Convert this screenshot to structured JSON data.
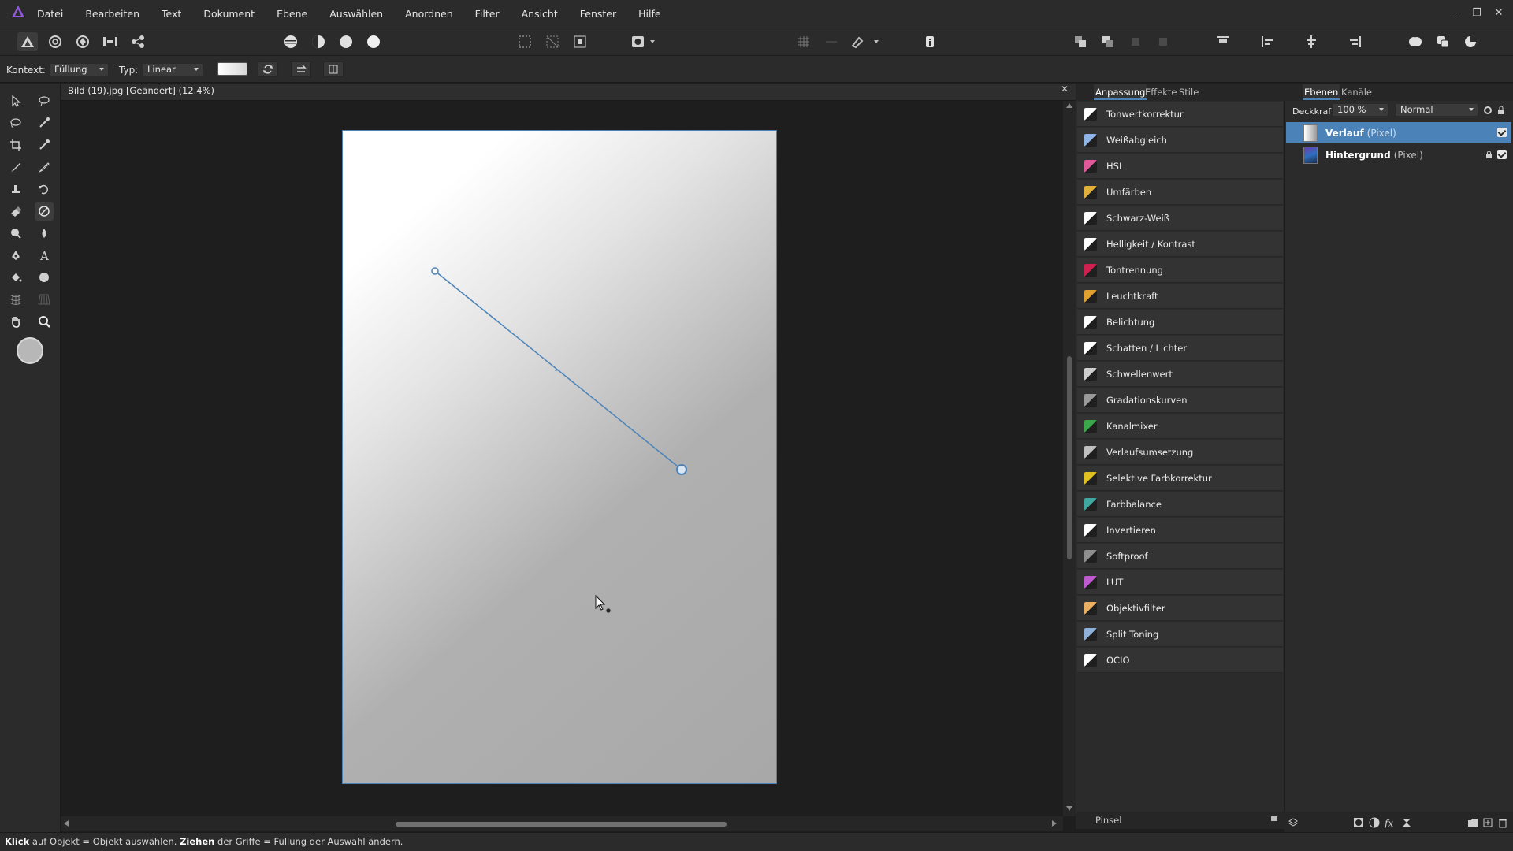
{
  "menu": [
    "Datei",
    "Bearbeiten",
    "Text",
    "Dokument",
    "Ebene",
    "Auswählen",
    "Anordnen",
    "Filter",
    "Ansicht",
    "Fenster",
    "Hilfe"
  ],
  "window_controls": {
    "minimize": "–",
    "restore": "❐",
    "close": "✕"
  },
  "context": {
    "kontext_label": "Kontext:",
    "kontext_value": "Füllung",
    "typ_label": "Typ:",
    "typ_value": "Linear"
  },
  "document": {
    "title": "Bild (19).jpg [Geändert] (12.4%)",
    "close": "✕"
  },
  "adjustment_panel": {
    "tabs": [
      "Anpassung",
      "Effekte",
      "Stile"
    ],
    "items": [
      {
        "label": "Tonwertkorrektur",
        "icon": "levels-icon",
        "color": "#ffffff"
      },
      {
        "label": "Weißabgleich",
        "icon": "white-balance-icon",
        "color": "#8fb4e6"
      },
      {
        "label": "HSL",
        "icon": "hsl-icon",
        "color": "#e05a9a"
      },
      {
        "label": "Umfärben",
        "icon": "recolor-icon",
        "color": "#e0b03a"
      },
      {
        "label": "Schwarz-Weiß",
        "icon": "black-white-icon",
        "color": "#ffffff"
      },
      {
        "label": "Helligkeit / Kontrast",
        "icon": "brightness-contrast-icon",
        "color": "#ffffff"
      },
      {
        "label": "Tontrennung",
        "icon": "posterize-icon",
        "color": "#d02050"
      },
      {
        "label": "Leuchtkraft",
        "icon": "vibrance-icon",
        "color": "#e0a030"
      },
      {
        "label": "Belichtung",
        "icon": "exposure-icon",
        "color": "#ffffff"
      },
      {
        "label": "Schatten / Lichter",
        "icon": "shadows-highlights-icon",
        "color": "#ffffff"
      },
      {
        "label": "Schwellenwert",
        "icon": "threshold-icon",
        "color": "#cfcfcf"
      },
      {
        "label": "Gradationskurven",
        "icon": "curves-icon",
        "color": "#9a9a9a"
      },
      {
        "label": "Kanalmixer",
        "icon": "channel-mixer-icon",
        "color": "#3aa84a"
      },
      {
        "label": "Verlaufsumsetzung",
        "icon": "gradient-map-icon",
        "color": "#bfbfbf"
      },
      {
        "label": "Selektive Farbkorrektur",
        "icon": "selective-color-icon",
        "color": "#e0c020"
      },
      {
        "label": "Farbbalance",
        "icon": "color-balance-icon",
        "color": "#40a8a0"
      },
      {
        "label": "Invertieren",
        "icon": "invert-icon",
        "color": "#ffffff"
      },
      {
        "label": "Softproof",
        "icon": "soft-proof-icon",
        "color": "#8f8f8f"
      },
      {
        "label": "LUT",
        "icon": "lut-icon",
        "color": "#c05ad0"
      },
      {
        "label": "Objektivfilter",
        "icon": "lens-filter-icon",
        "color": "#e8b060"
      },
      {
        "label": "Split Toning",
        "icon": "split-toning-icon",
        "color": "#8fb0d8"
      },
      {
        "label": "OCIO",
        "icon": "ocio-icon",
        "color": "#ffffff"
      }
    ],
    "footer_label": "Pinsel"
  },
  "layers_panel": {
    "tabs": [
      "Ebenen",
      "Kanäle"
    ],
    "opacity_label": "Deckkraft:",
    "opacity_value": "100 %",
    "blend_mode": "Normal",
    "layers": [
      {
        "name": "Verlauf",
        "kind": "(Pixel)",
        "selected": true
      },
      {
        "name": "Hintergrund",
        "kind": "(Pixel)",
        "selected": false
      }
    ]
  },
  "status": {
    "klick": "Klick",
    "part1": " auf Objekt = Objekt auswählen. ",
    "ziehen": "Ziehen",
    "part2": " der Griffe = Füllung der Auswahl ändern."
  },
  "colors": {
    "accent": "#4b83b8",
    "selected_layer": "#4b83b8",
    "panel_bg": "#2b2b2b",
    "app_bg": "#1e1e1e",
    "logo": "#8f5bd6"
  }
}
